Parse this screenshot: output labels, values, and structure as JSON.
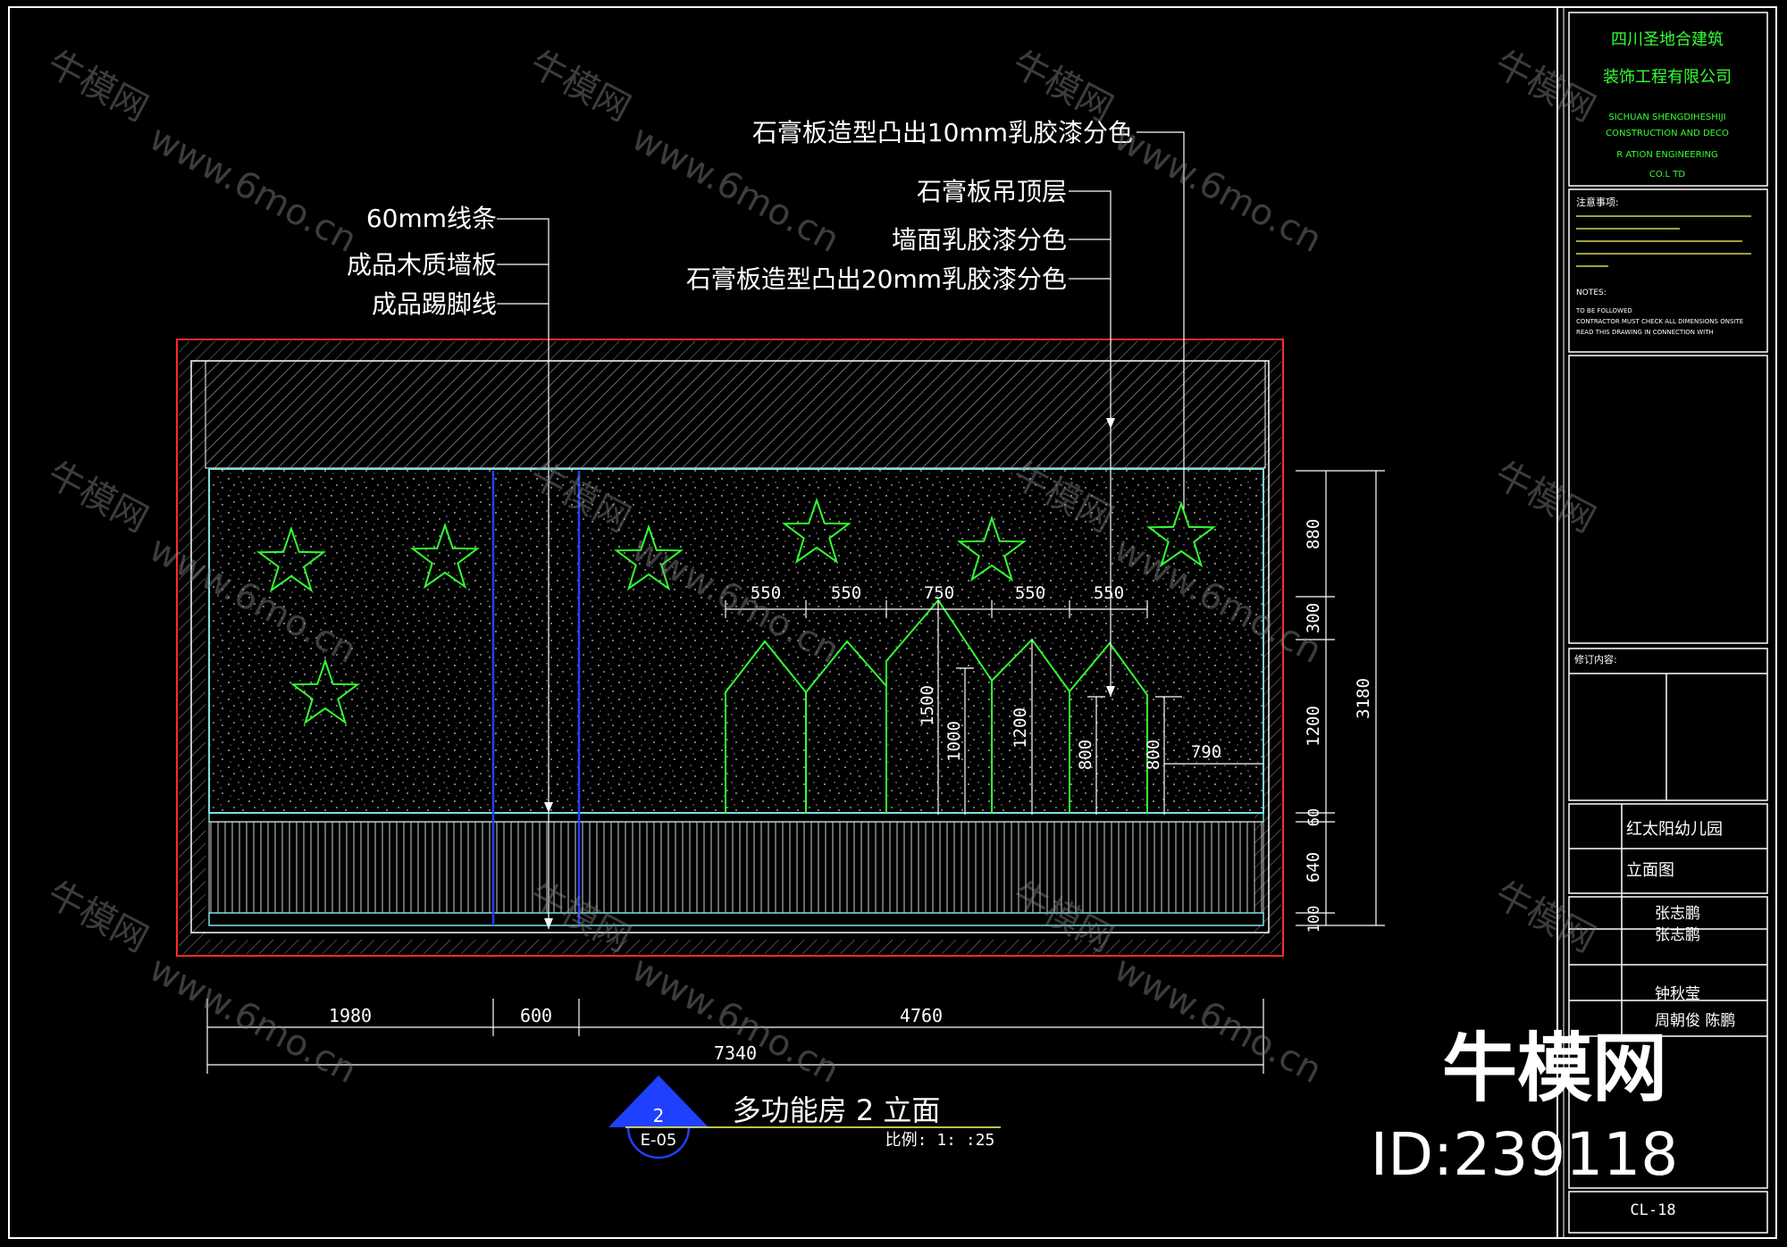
{
  "labels_left": [
    "60mm线条",
    "成品木质墙板",
    "成品踢脚线"
  ],
  "labels_right": [
    "石膏板造型凸出10mm乳胶漆分色",
    "石膏板吊顶层",
    "墙面乳胶漆分色",
    "石膏板造型凸出20mm乳胶漆分色"
  ],
  "dims_bottom": [
    "1980",
    "600",
    "4760"
  ],
  "dim_total": "7340",
  "dims_top": [
    "550",
    "550",
    "750",
    "550",
    "550"
  ],
  "dims_heights": [
    "1500",
    "1000",
    "1200",
    "800",
    "800"
  ],
  "dim_790": "790",
  "dims_right": [
    "880",
    "300",
    "1200",
    "60",
    "640",
    "100"
  ],
  "dim_right_total": "3180",
  "drawing_title": "多功能房 2 立面",
  "drawing_scale": "比例: 1: :25",
  "callout_num": "2",
  "callout_ref": "E-05",
  "title_block": {
    "company_cn1": "四川圣地合建筑",
    "company_cn2": "装饰工程有限公司",
    "company_en": [
      "SICHUAN SHENGDIHESHIJI",
      "CONSTRUCTION AND DECO",
      "R ATION ENGINEERING",
      "CO.L TD"
    ],
    "notes_title": "注意事项:",
    "notes_en_title": "NOTES:",
    "notes_en": [
      "TO BE FOLLOWED",
      "CONTRACTOR MUST CHECK ALL DIMENSIONS ONSITE",
      "READ THIS DRAWING IN CONNECTION WITH"
    ],
    "revision_label": "修订内容:",
    "project_name": "红太阳幼儿园",
    "drawing_type": "立面图",
    "designer": "张志鹏",
    "drafter": "张志鹏",
    "checker": "钟秋莹",
    "approver": "周朝俊 陈鹏",
    "drawing_no": "CL-18"
  },
  "watermark": {
    "brand": "牛模网",
    "url": "www.6mo.cn",
    "id": "ID:239118"
  },
  "colors": {
    "bg": "#000000",
    "green": "#33ff33",
    "cyan": "#7fe0e0",
    "red": "#ff2a2a",
    "blue": "#2040ff",
    "white": "#ffffff"
  }
}
